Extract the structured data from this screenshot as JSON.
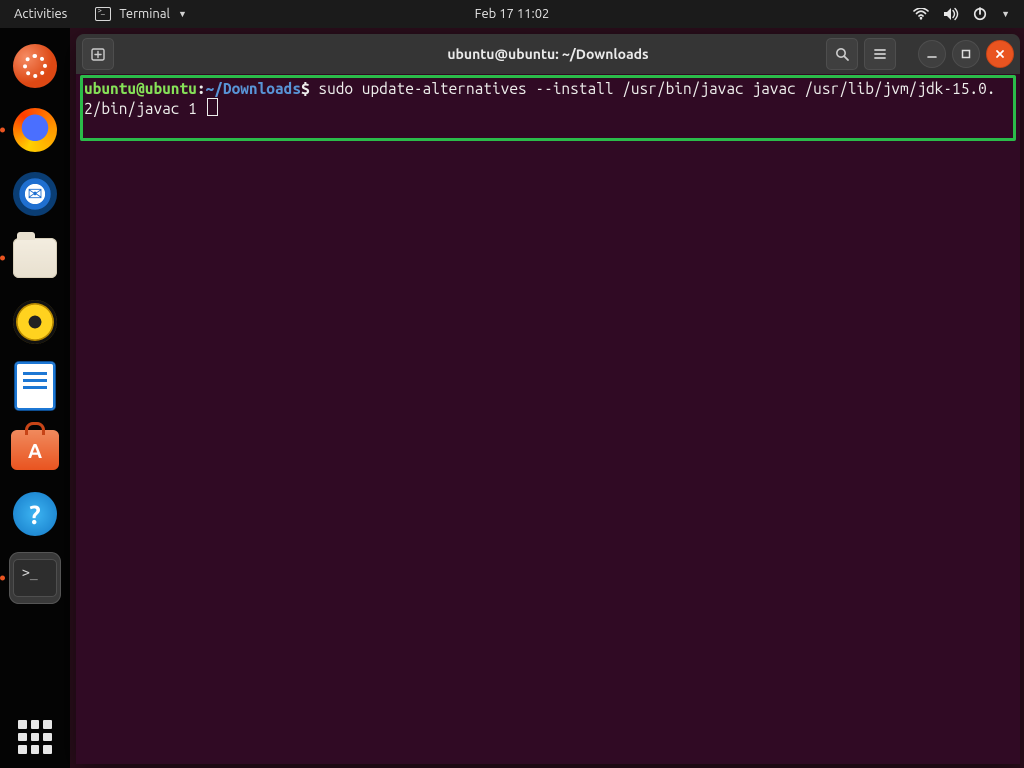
{
  "topbar": {
    "activities_label": "Activities",
    "active_app_label": "Terminal",
    "clock": "Feb 17  11:02"
  },
  "dock": {
    "items": [
      {
        "name": "ubuntu"
      },
      {
        "name": "firefox"
      },
      {
        "name": "thunderbird"
      },
      {
        "name": "files"
      },
      {
        "name": "rhythmbox"
      },
      {
        "name": "libreoffice-writer"
      },
      {
        "name": "ubuntu-software"
      },
      {
        "name": "help"
      },
      {
        "name": "terminal"
      }
    ],
    "terminal_glyph": ">_"
  },
  "window": {
    "title": "ubuntu@ubuntu: ~/Downloads",
    "newtab_glyph": "⊞"
  },
  "terminal": {
    "prompt_user": "ubuntu@ubuntu",
    "prompt_sep1": ":",
    "prompt_path": "~/Downloads",
    "prompt_sep2": "$",
    "command": "sudo update-alternatives --install /usr/bin/javac javac /usr/lib/jvm/jdk-15.0.2/bin/javac 1 "
  },
  "help_glyph": "?"
}
